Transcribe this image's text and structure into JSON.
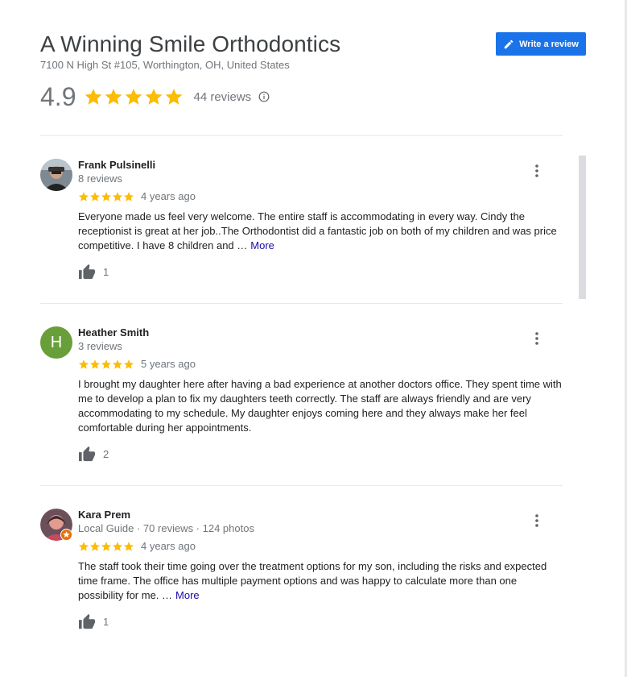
{
  "business": {
    "name": "A Winning Smile Orthodontics",
    "address": "7100 N High St #105, Worthington, OH, United States",
    "rating": "4.9",
    "review_count": "44 reviews",
    "write_review_label": "Write a review"
  },
  "colors": {
    "star": "#fbbc04",
    "accent": "#1a73e8",
    "link": "#1a0dab"
  },
  "reviews": [
    {
      "author": "Frank Pulsinelli",
      "meta": "8 reviews",
      "time": "4 years ago",
      "rating": 5,
      "text": "Everyone made us feel very welcome. The entire staff is accommodating in every way. Cindy the receptionist is great at her job..The Orthodontist did a fantastic job on both of my children and was price competitive. I have 8 children and …",
      "more_label": "More",
      "likes": "1",
      "avatar_icon": "photo-avatar"
    },
    {
      "author": "Heather Smith",
      "meta": "3 reviews",
      "time": "5 years ago",
      "rating": 5,
      "text": "I brought my daughter here after having a bad experience at another doctors office. They spent time with me to develop a plan to fix my daughters teeth correctly. The staff are always friendly and are very accommodating to my schedule. My daughter enjoys coming here and they always make her feel comfortable during her appointments.",
      "likes": "2",
      "avatar_letter": "H",
      "avatar_color": "#689f38"
    },
    {
      "author": "Kara Prem",
      "meta": "Local Guide · 70 reviews · 124 photos",
      "time": "4 years ago",
      "rating": 5,
      "text": "The staff took their time going over the treatment options for my son, including the risks and expected time frame.  The office has multiple payment options and was happy to calculate more than one possibility for me. …",
      "more_label": "More",
      "likes": "1",
      "avatar_icon": "photo-avatar",
      "badge_icon": "local-guide-badge"
    }
  ]
}
